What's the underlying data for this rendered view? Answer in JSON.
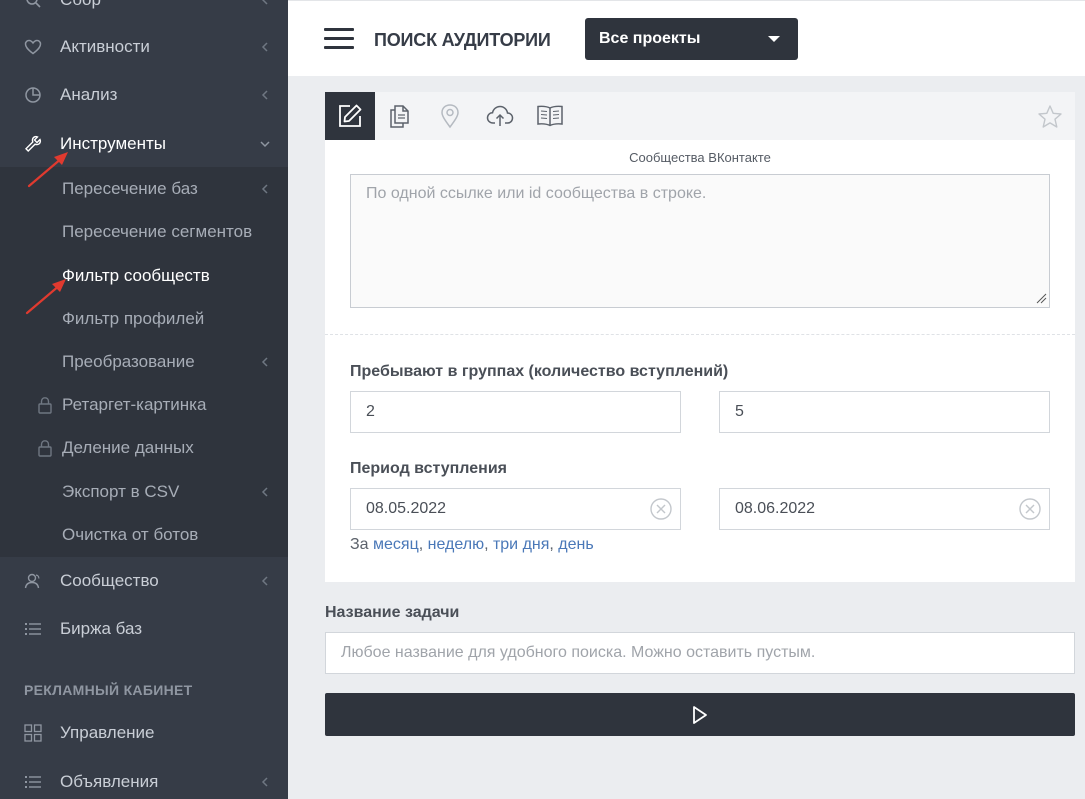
{
  "colors": {
    "sidebar_bg": "#363c47",
    "submenu_bg": "#2f343d",
    "accent_dark": "#2f343d",
    "link": "#4a78b8",
    "annotation_arrow": "#e03a2f"
  },
  "sidebar": {
    "items": [
      {
        "label": "Сбор",
        "icon": "collect-icon",
        "has_chevron": true
      },
      {
        "label": "Активности",
        "icon": "heart-icon",
        "has_chevron": true
      },
      {
        "label": "Анализ",
        "icon": "pie-chart-icon",
        "has_chevron": true
      },
      {
        "label": "Инструменты",
        "icon": "wrench-icon",
        "has_chevron": true,
        "expanded": true,
        "active": true
      },
      {
        "label": "Сообщество",
        "icon": "users-icon",
        "has_chevron": true
      },
      {
        "label": "Биржа баз",
        "icon": "list-icon",
        "has_chevron": false
      }
    ],
    "submenu": [
      {
        "label": "Пересечение баз",
        "has_chevron": true
      },
      {
        "label": "Пересечение сегментов",
        "has_chevron": false
      },
      {
        "label": "Фильтр сообществ",
        "active": true
      },
      {
        "label": "Фильтр профилей"
      },
      {
        "label": "Преобразование",
        "has_chevron": true
      },
      {
        "label": "Ретаргет-картинка",
        "locked": true
      },
      {
        "label": "Деление данных",
        "locked": true
      },
      {
        "label": "Экспорт в CSV",
        "has_chevron": true
      },
      {
        "label": "Очистка от ботов"
      }
    ],
    "section_title": "РЕКЛАМНЫЙ КАБИНЕТ",
    "ads_items": [
      {
        "label": "Управление",
        "icon": "grid-icon",
        "has_chevron": false
      },
      {
        "label": "Объявления",
        "icon": "list-icon",
        "has_chevron": true
      }
    ]
  },
  "header": {
    "title": "ПОИСК АУДИТОРИИ",
    "project_select": "Все проекты"
  },
  "tabs": [
    {
      "icon": "edit-icon",
      "active": true
    },
    {
      "icon": "files-icon"
    },
    {
      "icon": "location-pin-icon"
    },
    {
      "icon": "cloud-upload-icon"
    },
    {
      "icon": "book-icon"
    }
  ],
  "form": {
    "communities_caption": "Сообщества ВКонтакте",
    "communities_placeholder": "По одной ссылке или id сообщества в строке.",
    "groups_label": "Пребывают в группах (количество вступлений)",
    "groups_min": "2",
    "groups_max": "5",
    "period_label": "Период вступления",
    "date_from": "08.05.2022",
    "date_to": "08.06.2022",
    "quick_prefix": "За",
    "quick_links": [
      "месяц",
      "неделю",
      "три дня",
      "день"
    ],
    "task_label": "Название задачи",
    "task_placeholder": "Любое название для удобного поиска. Можно оставить пустым."
  }
}
